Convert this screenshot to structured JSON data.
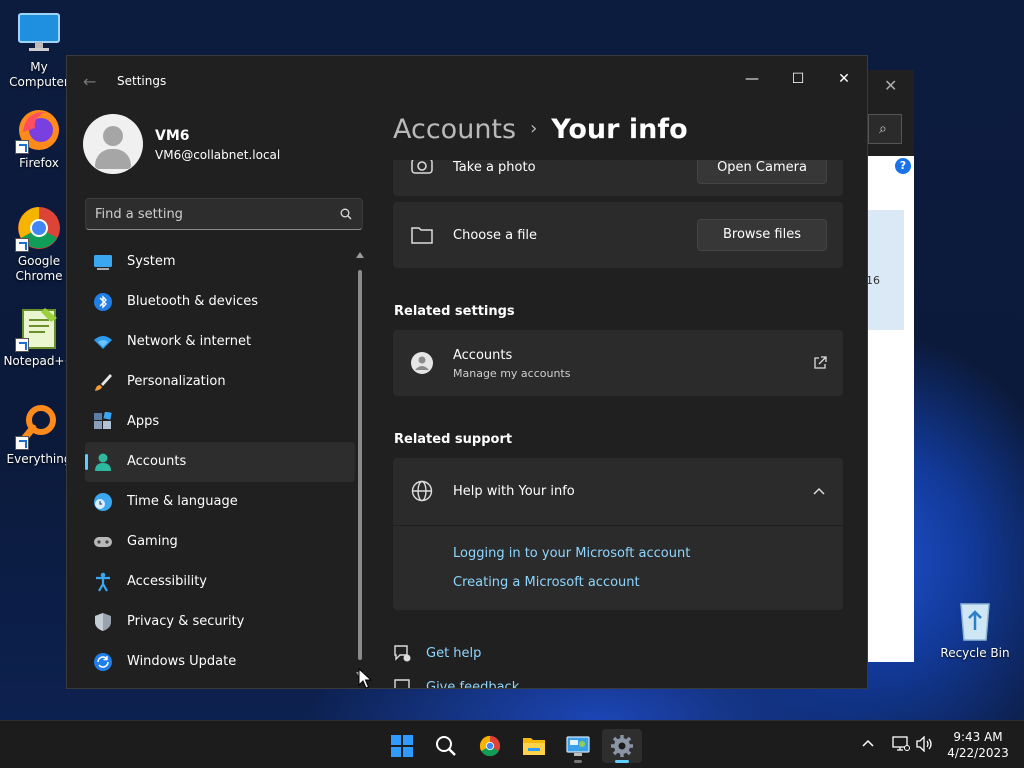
{
  "desktop": {
    "icons": [
      {
        "label": "My Computer",
        "icon": "monitor-icon"
      },
      {
        "label": "Firefox",
        "icon": "firefox-icon"
      },
      {
        "label": "Google Chrome",
        "icon": "chrome-icon"
      },
      {
        "label": "Notepad++",
        "icon": "notepadpp-icon"
      },
      {
        "label": "Everything",
        "icon": "everything-icon"
      },
      {
        "label": "Recycle Bin",
        "icon": "recycle-bin-icon"
      }
    ],
    "background_window": {
      "help_label": "?",
      "partial_text": "16"
    }
  },
  "window": {
    "title": "Settings",
    "controls": {
      "minimize": "—",
      "maximize": "☐",
      "close": "✕"
    }
  },
  "profile": {
    "name": "VM6",
    "email": "VM6@collabnet.local"
  },
  "search": {
    "placeholder": "Find a setting"
  },
  "nav": {
    "items": [
      {
        "label": "System",
        "icon": "system-icon"
      },
      {
        "label": "Bluetooth & devices",
        "icon": "bluetooth-icon"
      },
      {
        "label": "Network & internet",
        "icon": "wifi-icon"
      },
      {
        "label": "Personalization",
        "icon": "brush-icon"
      },
      {
        "label": "Apps",
        "icon": "apps-icon"
      },
      {
        "label": "Accounts",
        "icon": "accounts-icon",
        "selected": true
      },
      {
        "label": "Time & language",
        "icon": "globe-clock-icon"
      },
      {
        "label": "Gaming",
        "icon": "gamepad-icon"
      },
      {
        "label": "Accessibility",
        "icon": "accessibility-icon"
      },
      {
        "label": "Privacy & security",
        "icon": "shield-icon"
      },
      {
        "label": "Windows Update",
        "icon": "update-icon"
      }
    ]
  },
  "breadcrumb": {
    "parent": "Accounts",
    "separator": "›",
    "current": "Your info"
  },
  "content": {
    "take_photo": {
      "label": "Take a photo",
      "button": "Open Camera"
    },
    "choose_file": {
      "label": "Choose a file",
      "button": "Browse files"
    },
    "related_settings": {
      "heading": "Related settings",
      "accounts": {
        "title": "Accounts",
        "subtitle": "Manage my accounts"
      }
    },
    "related_support": {
      "heading": "Related support",
      "help_title": "Help with Your info",
      "links": [
        "Logging in to your Microsoft account",
        "Creating a Microsoft account"
      ]
    },
    "footer": {
      "get_help": "Get help",
      "give_feedback": "Give feedback"
    }
  },
  "taskbar": {
    "apps": [
      "start-icon",
      "search-icon",
      "chrome-icon",
      "file-explorer-icon",
      "control-panel-icon",
      "settings-icon"
    ],
    "active_app": "settings-icon",
    "clock": {
      "time": "9:43 AM",
      "date": "4/22/2023"
    }
  },
  "colors": {
    "accent": "#60cdff",
    "link": "#8fd6ff",
    "window_bg": "#202020",
    "card_bg": "#2b2b2b"
  }
}
